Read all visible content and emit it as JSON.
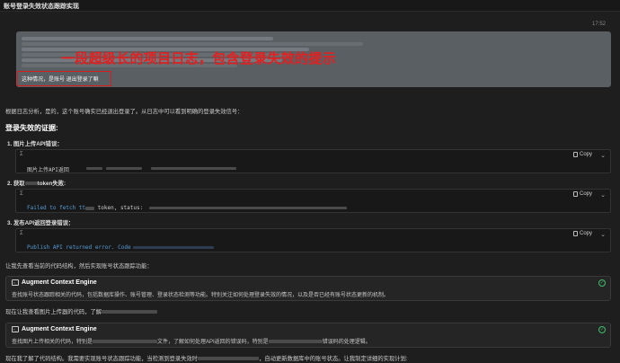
{
  "window": {
    "title": "账号登录失效状态跟踪实现"
  },
  "user_message": {
    "timestamp": "17:52",
    "annotation": "一段超级长的项目日志，包含登录失效的提示",
    "text": "这种情况，是账号 退出登录了嘛"
  },
  "assistant": {
    "intro": "根据日志分析，是的，这个账号确实已经退出登录了。从日志中可以看到明确的登录失效信号：",
    "heading": "登录失效的证据:",
    "evidence": [
      {
        "label": "1. 图片上传API错误：",
        "code": "图片上传API返回"
      },
      {
        "label_prefix": "2. 获取",
        "label_suffix": "token失败:",
        "code_prefix": "Failed to fetch tt",
        "code_suffix": "token, status:"
      },
      {
        "label": "3. 发布API返回登录错误：",
        "code": "Publish API returned error. Code"
      }
    ],
    "code_block": {
      "icon": "Σ",
      "copy_label": "Copy"
    },
    "after_evidence": "让我先查看当前的代码结构，然后实现账号状态跟踪功能：",
    "tool_calls": [
      {
        "title": "Augment Context Engine",
        "desc": "查找账号状态跟踪相关的代码，包括数据库操作、账号管理、登录状态检测等功能。特别关注如何处理登录失效的情况，以及是否已经有账号状态更新的机制。"
      },
      {
        "title": "Augment Context Engine",
        "desc_prefix": "查找图片上传相关的代码，特别是",
        "desc_mid": "文件，了解如何处理API返回的错误码，特别是",
        "desc_suffix": "错误码的处理逻辑。"
      }
    ],
    "between_tools": "现在让我查看图片上传器的代码，了解",
    "final_prefix": "现在我了解了代码结构。我需要实现账号状态跟踪功能，当检测到登录失效时",
    "final_suffix": "，自动更新数据库中的账号状态。让我制定详细的实现计划:"
  },
  "colors": {
    "background": "#1e1e1e",
    "user_bubble": "#5a5f63",
    "annotation_red": "#e81e1e",
    "code_keyword": "#569cd6",
    "success_green": "#3fbf6b"
  }
}
